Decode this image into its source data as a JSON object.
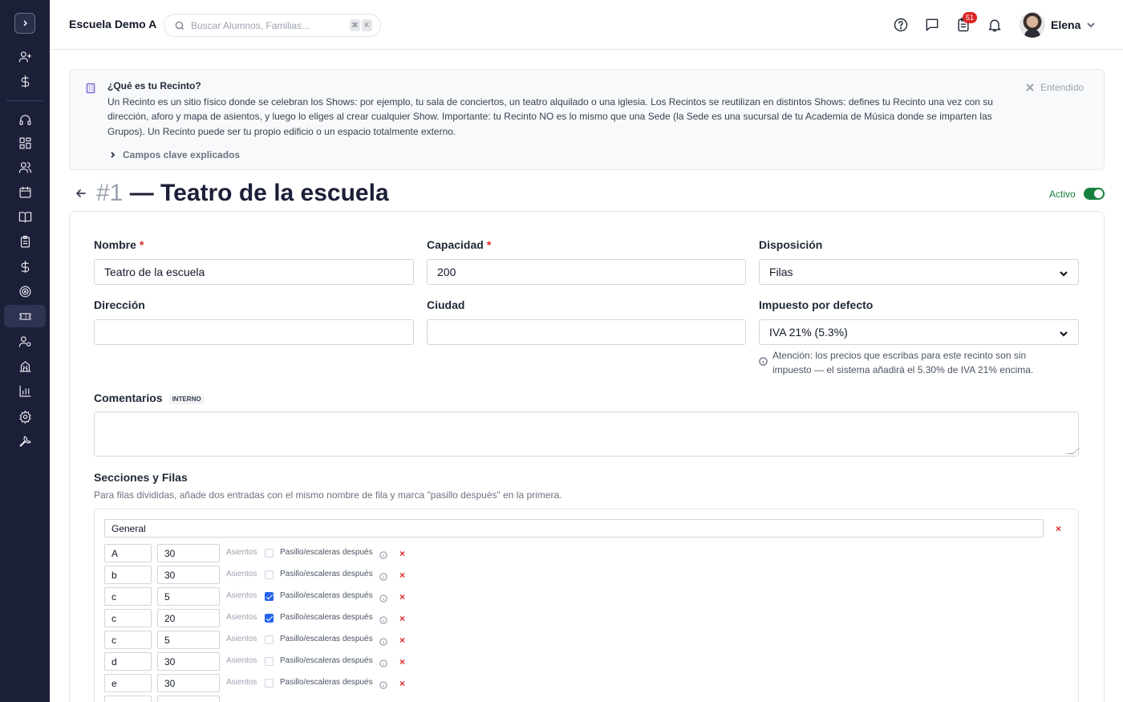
{
  "header": {
    "school_name": "Escuela Demo A",
    "search_placeholder": "Buscar Alumnos, Familias...",
    "kbd_1": "⌘",
    "kbd_2": "K",
    "notifications_count": "51",
    "user_name": "Elena"
  },
  "info": {
    "title": "¿Qué es tu Recinto?",
    "body": "Un Recinto es un sitio físico donde se celebran los Shows: por ejemplo, tu sala de conciertos, un teatro alquilado o una iglesia. Los Recintos se reutilizan en distintos Shows: defines tu Recinto una vez con su dirección, aforo y mapa de asientos, y luego lo eliges al crear cualquier Show. Importante: tu Recinto NO es lo mismo que una Sede (la Sede es una sucursal de tu Academia de Música donde se imparten las Grupos). Un Recinto puede ser tu propio edificio o un espacio totalmente externo.",
    "dismiss_label": "Entendido",
    "more_label": "Campos clave explicados"
  },
  "page": {
    "number": "#1",
    "title": "— Teatro de la escuela",
    "status_label": "Activo",
    "active": true
  },
  "form": {
    "name_label": "Nombre",
    "name_value": "Teatro de la escuela",
    "capacity_label": "Capacidad",
    "capacity_value": "200",
    "layout_label": "Disposición",
    "layout_value": "Filas",
    "address_label": "Dirección",
    "address_value": "",
    "city_label": "Ciudad",
    "city_value": "",
    "tax_label": "Impuesto por defecto",
    "tax_value": "IVA 21% (5.3%)",
    "tax_hint": "Atención: los precios que escribas para este recinto son sin impuesto — el sistema añadirá el 5.30% de IVA 21% encima.",
    "required_mark": "*",
    "comments_label": "Comentarios",
    "comments_badge": "INTERNO",
    "comments_value": ""
  },
  "sections": {
    "title": "Secciones y Filas",
    "subtitle": "Para filas divididas, añade dos entradas con el mismo nombre de fila y marca \"pasillo después\" en la primera.",
    "section_name": "General",
    "seats_label": "Asientos",
    "aisle_label": "Pasillo/escaleras después",
    "remove_glyph": "×",
    "rows": [
      {
        "row": "A",
        "seats": "30",
        "aisle": false
      },
      {
        "row": "b",
        "seats": "30",
        "aisle": false
      },
      {
        "row": "c",
        "seats": "5",
        "aisle": true
      },
      {
        "row": "c",
        "seats": "20",
        "aisle": true
      },
      {
        "row": "c",
        "seats": "5",
        "aisle": false
      },
      {
        "row": "d",
        "seats": "30",
        "aisle": false
      },
      {
        "row": "e",
        "seats": "30",
        "aisle": false
      }
    ]
  },
  "sidebar": {
    "items": [
      "expand-icon",
      "add-user-icon",
      "dollar-icon",
      "headset-icon",
      "dashboard-icon",
      "users-icon",
      "calendar-icon",
      "book-icon",
      "clipboard-icon",
      "dollar-icon",
      "target-icon",
      "ticket-icon",
      "user-settings-icon",
      "building-icon",
      "chart-icon",
      "gear-icon",
      "wrench-icon"
    ]
  },
  "colors": {
    "sidebar_bg": "#1c1f38",
    "accent_green": "#15803d",
    "danger": "#dc2626",
    "checkbox": "#2563eb"
  }
}
